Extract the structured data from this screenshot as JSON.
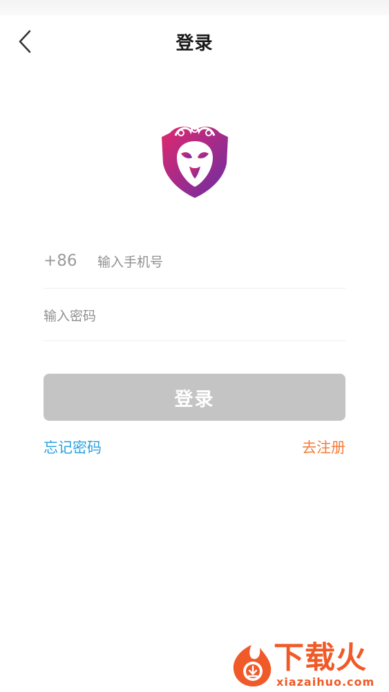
{
  "header": {
    "title": "登录",
    "back_icon": "chevron-left-icon"
  },
  "logo": {
    "icon": "monkey-shield-logo",
    "colors": {
      "top": "#e0286e",
      "bottom": "#6a2ea3"
    }
  },
  "form": {
    "country_code": "+86",
    "phone_placeholder": "输入手机号",
    "phone_value": "",
    "password_placeholder": "输入密码",
    "password_value": ""
  },
  "login_button": {
    "label": "登录",
    "color": "#c4c4c4"
  },
  "links": {
    "forgot_password": "忘记密码",
    "register": "去注册",
    "forgot_color": "#29a3e0",
    "register_color": "#f47d3a"
  },
  "watermark": {
    "text": "下载火",
    "sub": "xiazaihuo.com",
    "color": "#f05a28"
  }
}
